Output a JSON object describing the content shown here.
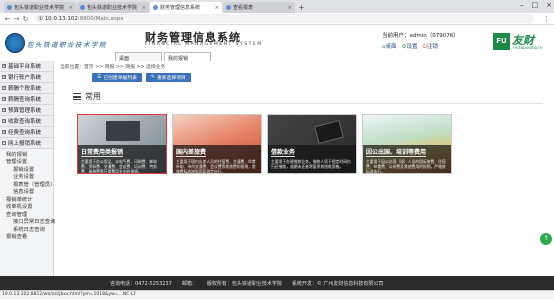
{
  "browser": {
    "tabs": [
      {
        "label": "包头铁道职业技术学院"
      },
      {
        "label": "包头铁道职业技术学院"
      },
      {
        "label": "财务管理信息系统"
      },
      {
        "label": "查看报表"
      }
    ],
    "url_prefix": "① 10.0.13.102",
    "url_rest": ":8800/Main.aspx"
  },
  "header": {
    "logo_text": "包头铁道职业技术学院",
    "title": "财务管理信息系统",
    "subtitle": "FINANCIAL MANAGEMENT SYSTEM",
    "tabs": [
      "桌面",
      "我的报销"
    ],
    "user_label": "当前用户：admin（079076）",
    "links": [
      "桌面",
      "设置",
      "注销"
    ],
    "brand_mark": "FU",
    "brand_name": "友财",
    "brand_sub": "FRIENDSWEALTH"
  },
  "sidebar": {
    "items": [
      {
        "label": "基础平台系统",
        "marker": "+"
      },
      {
        "label": "银行账户系统",
        "marker": "+"
      },
      {
        "label": "薪酬个税系统",
        "marker": "+"
      },
      {
        "label": "薪酬查询系统",
        "marker": "+"
      },
      {
        "label": "预算管理系统",
        "marker": "+"
      },
      {
        "label": "收款查询系统",
        "marker": "+"
      },
      {
        "label": "经费查询系统",
        "marker": "+"
      },
      {
        "label": "网上报销系统",
        "marker": "−"
      }
    ],
    "subs": [
      {
        "label": "我的报销",
        "indent": 1
      },
      {
        "label": "管理设置",
        "indent": 1
      },
      {
        "label": "报销设置",
        "indent": 2
      },
      {
        "label": "业务设置",
        "indent": 2
      },
      {
        "label": "报表管（管理员）",
        "indent": 2
      },
      {
        "label": "信息设置",
        "indent": 2
      },
      {
        "label": "报销单统计",
        "indent": 1
      },
      {
        "label": "收单机设置",
        "indent": 1
      },
      {
        "label": "查询管理",
        "indent": 1
      },
      {
        "label": "接口异常日志查询",
        "indent": 2
      },
      {
        "label": "系统日志查询",
        "indent": 2
      },
      {
        "label": "报销查看",
        "indent": 1
      }
    ]
  },
  "main": {
    "breadcrumb": "当前位置：首页 >> 网报 >> 网报 >> 选择业务",
    "buttons": [
      "已创建单据列表",
      "重新选择项目"
    ],
    "section_title": "常用",
    "cards": [
      {
        "title": "日常费用类报销",
        "desc": "主要用于办公用品、水电气费、印刷费、邮电费、资料费、交通费、会议费、培训费、劳务费、维修费等日常费用支出的报销。"
      },
      {
        "title": "国内差旅费",
        "desc": "主要用于国内出差人员的住宿费、交通费、伙食补助、市内交通费、会议费等差旅费的报销，差旅费标准按照国家规定执行。"
      },
      {
        "title": "借款业务",
        "desc": "主要用于办理借款业务，借款人须于规定时间内归还借款，逾期未还者将暂停其借款资格。"
      },
      {
        "title": "因公出国、培训等费用",
        "desc": "主要用于因公出国（境）人员的国际旅费、住宿费、伙食费、公杂费及其他费用的报销，严格按标准执行。"
      }
    ]
  },
  "footer": {
    "texts": [
      "咨询电话：0472-5253237",
      "邮箱：",
      "版权所有：包头铁道职业技术学院",
      "系统开发：© 广州友财信息科技有限公司"
    ]
  },
  "status": {
    "text": "10.0.13.102:8812/wb/ssl/jbxx.html?ym=1018&yw=...NC-LF"
  },
  "colors": {
    "accent": "#3b6fb6",
    "brand_green": "#1d8a4a",
    "selection_red": "#e23b3b",
    "footer_bg": "#2a2a2a"
  }
}
